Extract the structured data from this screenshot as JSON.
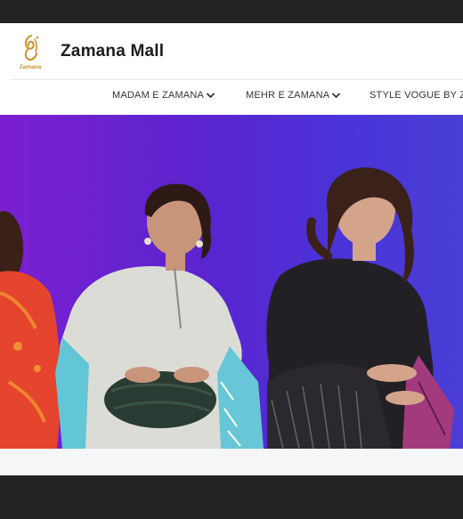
{
  "brand": {
    "name": "Zamana Mall",
    "logo_text": "Zamana"
  },
  "nav": {
    "items": [
      {
        "label": "MADAM E ZAMANA"
      },
      {
        "label": "MEHR E ZAMANA"
      },
      {
        "label": "STYLE VOGUE BY ZAM"
      }
    ]
  },
  "hero": {
    "image": "banner-models-photo"
  },
  "colors": {
    "hero_gradient_start": "#7a1fd0",
    "hero_gradient_end": "#4a3ed6",
    "logo_gold": "#c8912a"
  }
}
